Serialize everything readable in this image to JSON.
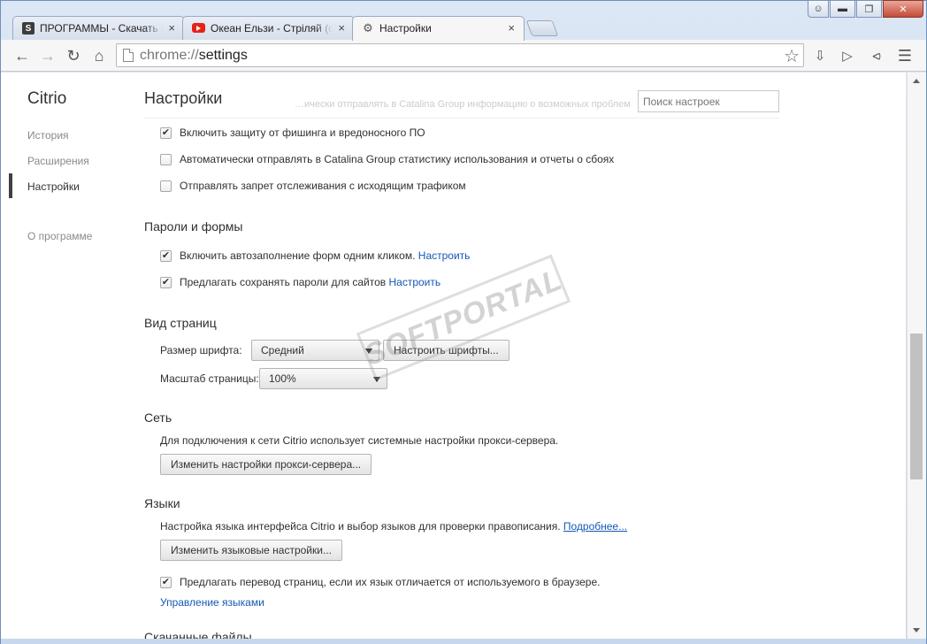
{
  "window": {
    "controls": [
      "user",
      "minimize",
      "maximize",
      "close"
    ]
  },
  "tabs": [
    {
      "title": "ПРОГРАММЫ - Скачать бесплатные программы",
      "favicon": "s-icon",
      "close": "×"
    },
    {
      "title": "Океан Ельзи - Стріляй (official video)",
      "favicon": "youtube-icon",
      "close": "×"
    },
    {
      "title": "Настройки",
      "favicon": "gear-icon",
      "close": "×"
    }
  ],
  "toolbar": {
    "url_scheme": "chrome://",
    "url_path": "settings"
  },
  "sidebar": {
    "brand": "Citrio",
    "items": [
      {
        "label": "История"
      },
      {
        "label": "Расширения"
      },
      {
        "label": "Настройки"
      },
      {
        "label": "О программе"
      }
    ]
  },
  "header": {
    "title": "Настройки",
    "ghost_text": "…ически отправлять в Catalina Group информацию о возможных проблемах безопасности",
    "search_placeholder": "Поиск настроек"
  },
  "privacy": {
    "items": [
      {
        "label": "Включить защиту от фишинга и вредоносного ПО",
        "checked": true
      },
      {
        "label": "Автоматически отправлять в Catalina Group статистику использования и отчеты о сбоях",
        "checked": false
      },
      {
        "label": "Отправлять запрет отслеживания с исходящим трафиком",
        "checked": false
      }
    ]
  },
  "passwords": {
    "heading": "Пароли и формы",
    "items": [
      {
        "label": "Включить автозаполнение форм одним кликом.",
        "link": "Настроить",
        "checked": true
      },
      {
        "label": "Предлагать сохранять пароли для сайтов",
        "link": "Настроить",
        "checked": true
      }
    ]
  },
  "appearance": {
    "heading": "Вид страниц",
    "font_size_label": "Размер шрифта:",
    "font_size_value": "Средний",
    "customize_fonts_button": "Настроить шрифты...",
    "zoom_label": "Масштаб страницы:",
    "zoom_value": "100%"
  },
  "network": {
    "heading": "Сеть",
    "description": "Для подключения к сети Citrio использует системные настройки прокси-сервера.",
    "proxy_button": "Изменить настройки прокси-сервера..."
  },
  "languages": {
    "heading": "Языки",
    "description": "Настройка языка интерфейса Citrio и выбор языков для проверки правописания.",
    "more_link": "Подробнее...",
    "language_button": "Изменить языковые настройки...",
    "translate_label": "Предлагать перевод страниц, если их язык отличается от используемого в браузере.",
    "translate_checked": true,
    "manage_link": "Управление языками"
  },
  "downloads": {
    "heading": "Скачанные файлы"
  },
  "watermark": {
    "text": "SOFTPORTAL"
  }
}
